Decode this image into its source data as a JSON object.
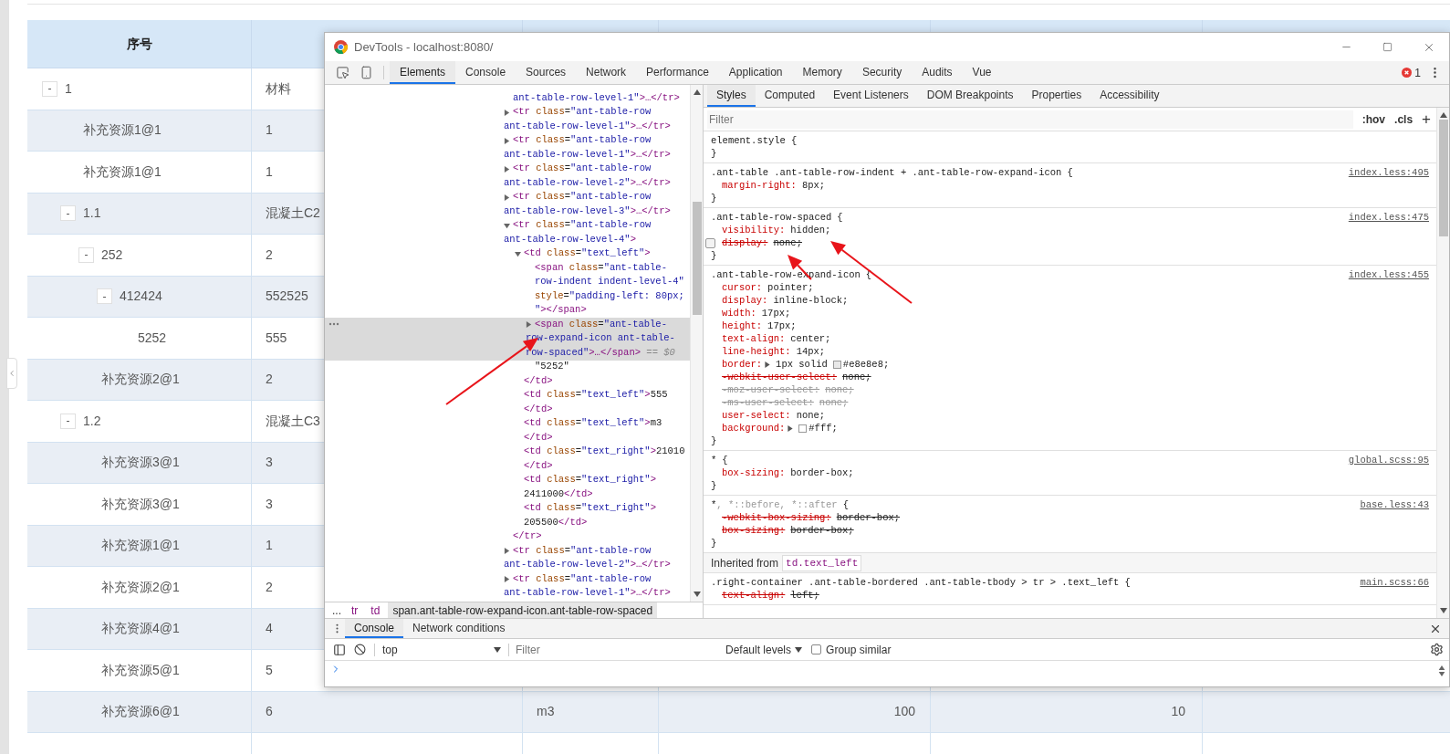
{
  "table": {
    "header": [
      {
        "label": "序号"
      }
    ],
    "rows": [
      {
        "label": "1",
        "toggle": "-",
        "cells": [
          "材料"
        ],
        "children": [
          {
            "label": "补充资源1@1",
            "cells": [
              "1"
            ]
          },
          {
            "label": "补充资源1@1",
            "cells": [
              "1"
            ]
          },
          {
            "label": "1.1",
            "toggle": "-",
            "cells": [
              "混凝土C2"
            ],
            "children": [
              {
                "label": "252",
                "toggle": "-",
                "cells": [
                  "2"
                ],
                "children": [
                  {
                    "label": "412424",
                    "toggle": "-",
                    "cells": [
                      "552525"
                    ],
                    "children": [
                      {
                        "label": "5252",
                        "cells": [
                          "555"
                        ]
                      }
                    ]
                  }
                ]
              },
              {
                "label": "补充资源2@1",
                "cells": [
                  "2"
                ]
              }
            ]
          },
          {
            "label": "1.2",
            "toggle": "-",
            "cells": [
              "混凝土C3"
            ],
            "children": [
              {
                "label": "补充资源3@1",
                "cells": [
                  "3"
                ]
              },
              {
                "label": "补充资源3@1",
                "cells": [
                  "3"
                ]
              },
              {
                "label": "补充资源1@1",
                "cells": [
                  "1"
                ]
              },
              {
                "label": "补充资源2@1",
                "cells": [
                  "2"
                ]
              },
              {
                "label": "补充资源4@1",
                "cells": [
                  "4"
                ]
              },
              {
                "label": "补充资源5@1",
                "cells": [
                  "5"
                ]
              },
              {
                "label": "补充资源6@1",
                "cells": [
                  "6",
                  "m3",
                  "100",
                  "10"
                ]
              }
            ]
          }
        ]
      }
    ]
  },
  "devtools": {
    "title": "DevTools - localhost:8080/",
    "tabs": [
      {
        "label": "Elements",
        "selected": true
      },
      {
        "label": "Console",
        "selected": false
      },
      {
        "label": "Sources",
        "selected": false
      },
      {
        "label": "Network",
        "selected": false
      },
      {
        "label": "Performance",
        "selected": false
      },
      {
        "label": "Application",
        "selected": false
      },
      {
        "label": "Memory",
        "selected": false
      },
      {
        "label": "Security",
        "selected": false
      },
      {
        "label": "Audits",
        "selected": false
      },
      {
        "label": "Vue",
        "selected": false
      }
    ],
    "error_count": "1",
    "dom_tree": [
      {
        "selected": false,
        "lines": [
          [
            {
              "kind": "value",
              "text": "ant-table-row-level-1\""
            },
            {
              "kind": "tag",
              "text": ">…</tr>"
            }
          ]
        ]
      },
      {
        "expanded": false,
        "selected": false,
        "lines": [
          [
            {
              "kind": "tag",
              "text": "<tr"
            },
            {
              "kind": "attr",
              "text": " class"
            },
            {
              "kind": "plain",
              "text": "="
            },
            {
              "kind": "value",
              "text": "\"ant-table-row"
            }
          ],
          [
            {
              "kind": "value",
              "text": "ant-table-row-level-1\""
            },
            {
              "kind": "tag",
              "text": ">…</tr>"
            }
          ]
        ]
      },
      {
        "expanded": false,
        "selected": false,
        "lines": [
          [
            {
              "kind": "tag",
              "text": "<tr"
            },
            {
              "kind": "attr",
              "text": " class"
            },
            {
              "kind": "plain",
              "text": "="
            },
            {
              "kind": "value",
              "text": "\"ant-table-row"
            }
          ],
          [
            {
              "kind": "value",
              "text": "ant-table-row-level-1\""
            },
            {
              "kind": "tag",
              "text": ">…</tr>"
            }
          ]
        ]
      },
      {
        "expanded": false,
        "selected": false,
        "lines": [
          [
            {
              "kind": "tag",
              "text": "<tr"
            },
            {
              "kind": "attr",
              "text": " class"
            },
            {
              "kind": "plain",
              "text": "="
            },
            {
              "kind": "value",
              "text": "\"ant-table-row"
            }
          ],
          [
            {
              "kind": "value",
              "text": "ant-table-row-level-2\""
            },
            {
              "kind": "tag",
              "text": ">…</tr>"
            }
          ]
        ]
      },
      {
        "expanded": false,
        "selected": false,
        "lines": [
          [
            {
              "kind": "tag",
              "text": "<tr"
            },
            {
              "kind": "attr",
              "text": " class"
            },
            {
              "kind": "plain",
              "text": "="
            },
            {
              "kind": "value",
              "text": "\"ant-table-row"
            }
          ],
          [
            {
              "kind": "value",
              "text": "ant-table-row-level-3\""
            },
            {
              "kind": "tag",
              "text": ">…</tr>"
            }
          ]
        ]
      },
      {
        "expanded": true,
        "selected": false,
        "lines": [
          [
            {
              "kind": "tag",
              "text": "<tr"
            },
            {
              "kind": "attr",
              "text": " class"
            },
            {
              "kind": "plain",
              "text": "="
            },
            {
              "kind": "value",
              "text": "\"ant-table-row"
            }
          ],
          [
            {
              "kind": "value",
              "text": "ant-table-row-level-4\""
            },
            {
              "kind": "tag",
              "text": ">"
            }
          ]
        ],
        "children": [
          {
            "expanded": true,
            "selected": false,
            "lines": [
              [
                {
                  "kind": "tag",
                  "text": "<td"
                },
                {
                  "kind": "attr",
                  "text": " class"
                },
                {
                  "kind": "plain",
                  "text": "="
                },
                {
                  "kind": "value",
                  "text": "\"text_left\""
                },
                {
                  "kind": "tag",
                  "text": ">"
                }
              ]
            ],
            "children": [
              {
                "selected": false,
                "lines": [
                  [
                    {
                      "kind": "tag",
                      "text": "<span"
                    },
                    {
                      "kind": "attr",
                      "text": " class"
                    },
                    {
                      "kind": "plain",
                      "text": "="
                    },
                    {
                      "kind": "value",
                      "text": "\"ant-table-"
                    }
                  ],
                  [
                    {
                      "kind": "value",
                      "text": "row-indent indent-level-4\""
                    }
                  ],
                  [
                    {
                      "kind": "attr",
                      "text": "style"
                    },
                    {
                      "kind": "plain",
                      "text": "="
                    },
                    {
                      "kind": "value",
                      "text": "\"padding-left: 80px;"
                    }
                  ],
                  [
                    {
                      "kind": "value",
                      "text": "\""
                    },
                    {
                      "kind": "tag",
                      "text": "></span>"
                    }
                  ]
                ]
              },
              {
                "expanded": false,
                "selected": true,
                "lines": [
                  [
                    {
                      "kind": "tag",
                      "text": "<span"
                    },
                    {
                      "kind": "attr",
                      "text": " class"
                    },
                    {
                      "kind": "plain",
                      "text": "="
                    },
                    {
                      "kind": "value",
                      "text": "\"ant-table-"
                    }
                  ],
                  [
                    {
                      "kind": "value",
                      "text": "row-expand-icon ant-table-"
                    }
                  ],
                  [
                    {
                      "kind": "value",
                      "text": "row-spaced\""
                    },
                    {
                      "kind": "tag",
                      "text": ">…</span>"
                    },
                    {
                      "kind": "muted",
                      "text": " == $0"
                    }
                  ]
                ]
              },
              {
                "selected": false,
                "lines": [
                  [
                    {
                      "kind": "plain",
                      "text": "\"5252\""
                    }
                  ]
                ]
              }
            ],
            "close": [
              [
                {
                  "kind": "tag",
                  "text": "</td>"
                }
              ]
            ]
          },
          {
            "selected": false,
            "lines": [
              [
                {
                  "kind": "tag",
                  "text": "<td"
                },
                {
                  "kind": "attr",
                  "text": " class"
                },
                {
                  "kind": "plain",
                  "text": "="
                },
                {
                  "kind": "value",
                  "text": "\"text_left\""
                },
                {
                  "kind": "tag",
                  "text": ">"
                },
                {
                  "kind": "plain",
                  "text": "555"
                }
              ],
              [
                {
                  "kind": "tag",
                  "text": "</td>"
                }
              ]
            ]
          },
          {
            "selected": false,
            "lines": [
              [
                {
                  "kind": "tag",
                  "text": "<td"
                },
                {
                  "kind": "attr",
                  "text": " class"
                },
                {
                  "kind": "plain",
                  "text": "="
                },
                {
                  "kind": "value",
                  "text": "\"text_left\""
                },
                {
                  "kind": "tag",
                  "text": ">"
                },
                {
                  "kind": "plain",
                  "text": "m3"
                }
              ],
              [
                {
                  "kind": "tag",
                  "text": "</td>"
                }
              ]
            ]
          },
          {
            "selected": false,
            "lines": [
              [
                {
                  "kind": "tag",
                  "text": "<td"
                },
                {
                  "kind": "attr",
                  "text": " class"
                },
                {
                  "kind": "plain",
                  "text": "="
                },
                {
                  "kind": "value",
                  "text": "\"text_right\""
                },
                {
                  "kind": "tag",
                  "text": ">"
                },
                {
                  "kind": "plain",
                  "text": "21010"
                }
              ],
              [
                {
                  "kind": "tag",
                  "text": "</td>"
                }
              ]
            ]
          },
          {
            "selected": false,
            "lines": [
              [
                {
                  "kind": "tag",
                  "text": "<td"
                },
                {
                  "kind": "attr",
                  "text": " class"
                },
                {
                  "kind": "plain",
                  "text": "="
                },
                {
                  "kind": "value",
                  "text": "\"text_right\""
                },
                {
                  "kind": "tag",
                  "text": ">"
                }
              ],
              [
                {
                  "kind": "plain",
                  "text": "2411000"
                },
                {
                  "kind": "tag",
                  "text": "</td>"
                }
              ]
            ]
          },
          {
            "selected": false,
            "lines": [
              [
                {
                  "kind": "tag",
                  "text": "<td"
                },
                {
                  "kind": "attr",
                  "text": " class"
                },
                {
                  "kind": "plain",
                  "text": "="
                },
                {
                  "kind": "value",
                  "text": "\"text_right\""
                },
                {
                  "kind": "tag",
                  "text": ">"
                }
              ],
              [
                {
                  "kind": "plain",
                  "text": "205500"
                },
                {
                  "kind": "tag",
                  "text": "</td>"
                }
              ]
            ]
          }
        ],
        "close": [
          [
            {
              "kind": "tag",
              "text": "</tr>"
            }
          ]
        ]
      },
      {
        "expanded": false,
        "selected": false,
        "lines": [
          [
            {
              "kind": "tag",
              "text": "<tr"
            },
            {
              "kind": "attr",
              "text": " class"
            },
            {
              "kind": "plain",
              "text": "="
            },
            {
              "kind": "value",
              "text": "\"ant-table-row"
            }
          ],
          [
            {
              "kind": "value",
              "text": "ant-table-row-level-2\""
            },
            {
              "kind": "tag",
              "text": ">…</tr>"
            }
          ]
        ]
      },
      {
        "expanded": false,
        "selected": false,
        "lines": [
          [
            {
              "kind": "tag",
              "text": "<tr"
            },
            {
              "kind": "attr",
              "text": " class"
            },
            {
              "kind": "plain",
              "text": "="
            },
            {
              "kind": "value",
              "text": "\"ant-table-row"
            }
          ],
          [
            {
              "kind": "value",
              "text": "ant-table-row-level-1\""
            },
            {
              "kind": "tag",
              "text": ">…</tr>"
            }
          ]
        ]
      }
    ],
    "breadcrumb": {
      "overflow": "...",
      "items": [
        {
          "label": "tr",
          "kind": "tag",
          "selected": false
        },
        {
          "label": "td",
          "kind": "tag",
          "selected": false
        },
        {
          "label": "span.ant-table-row-expand-icon.ant-table-row-spaced",
          "kind": "node",
          "selected": true
        }
      ]
    },
    "styles": {
      "tabs": [
        {
          "label": "Styles",
          "selected": true
        },
        {
          "label": "Computed",
          "selected": false
        },
        {
          "label": "Event Listeners",
          "selected": false
        },
        {
          "label": "DOM Breakpoints",
          "selected": false
        },
        {
          "label": "Properties",
          "selected": false
        },
        {
          "label": "Accessibility",
          "selected": false
        }
      ],
      "filter_placeholder": "Filter",
      "hov": ":hov",
      "cls": ".cls",
      "add": "+",
      "rules": [
        {
          "selector": [
            {
              "text": "element.style",
              "matched": true
            }
          ],
          "open": "{",
          "close": "}"
        },
        {
          "selector": [
            {
              "text": ".ant-table .ant-table-row-indent + .ant-table-row-expand-icon",
              "matched": true
            }
          ],
          "open": "{",
          "close": "}",
          "source": "index.less:495",
          "props": [
            {
              "name": "margin-right:",
              "value": "8px;",
              "kind": "active"
            }
          ]
        },
        {
          "selector": [
            {
              "text": ".ant-table-row-spaced",
              "matched": true
            }
          ],
          "open": "{",
          "close": "}",
          "source": "index.less:475",
          "props": [
            {
              "name": "visibility:",
              "value": "hidden;",
              "kind": "active"
            },
            {
              "name": "display:",
              "value": "none;",
              "kind": "disabled"
            }
          ]
        },
        {
          "selector": [
            {
              "text": ".ant-table-row-expand-icon",
              "matched": true
            }
          ],
          "open": "{",
          "close": "}",
          "source": "index.less:455",
          "props": [
            {
              "name": "cursor:",
              "value": "pointer;",
              "kind": "active"
            },
            {
              "name": "display:",
              "value": "inline-block;",
              "kind": "active"
            },
            {
              "name": "width:",
              "value": "17px;",
              "kind": "active"
            },
            {
              "name": "height:",
              "value": "17px;",
              "kind": "active"
            },
            {
              "name": "text-align:",
              "value": "center;",
              "kind": "active"
            },
            {
              "name": "line-height:",
              "value": "14px;",
              "kind": "active"
            },
            {
              "name": "border:",
              "value": "1px solid",
              "color": "#e8e8e8",
              "color_text": "#e8e8e8;",
              "kind": "active",
              "expandable": true
            },
            {
              "name": "-webkit-user-select:",
              "value": "none;",
              "kind": "overridden"
            },
            {
              "name": "-moz-user-select:",
              "value": "none;",
              "kind": "unsupported"
            },
            {
              "name": "-ms-user-select:",
              "value": "none;",
              "kind": "unsupported"
            },
            {
              "name": "user-select:",
              "value": "none;",
              "kind": "active"
            },
            {
              "name": "background:",
              "color": "#ffffff",
              "color_text": "#fff;",
              "kind": "active",
              "expandable": true
            }
          ]
        },
        {
          "selector": [
            {
              "text": "*",
              "matched": true
            }
          ],
          "open": "{",
          "close": "}",
          "source": "global.scss:95",
          "props": [
            {
              "name": "box-sizing:",
              "value": "border-box;",
              "kind": "active"
            }
          ]
        },
        {
          "selector": [
            {
              "text": "*",
              "matched": true
            },
            {
              "text": ", *::before, *::after",
              "matched": false
            }
          ],
          "open": "{",
          "close": "}",
          "source": "base.less:43",
          "props": [
            {
              "name": "-webkit-box-sizing:",
              "value": "border-box;",
              "kind": "overridden"
            },
            {
              "name": "box-sizing:",
              "value": "border-box;",
              "kind": "overridden"
            }
          ]
        },
        {
          "inherited_label": "Inherited from",
          "inherited_node": "td.text_left"
        },
        {
          "selector": [
            {
              "text": ".right-container .ant-table-bordered .ant-table-tbody > tr > .text_left",
              "matched": true
            }
          ],
          "open": "{",
          "source": "main.scss:66",
          "props": [
            {
              "name": "text-align:",
              "value": "left;",
              "kind": "overridden"
            }
          ]
        }
      ]
    },
    "console": {
      "tabs": [
        {
          "label": "Console",
          "selected": true
        },
        {
          "label": "Network conditions",
          "selected": false
        }
      ],
      "context": "top",
      "filter_placeholder": "Filter",
      "levels": "Default levels",
      "group_similar": {
        "label": "Group similar",
        "checked": false
      }
    }
  }
}
